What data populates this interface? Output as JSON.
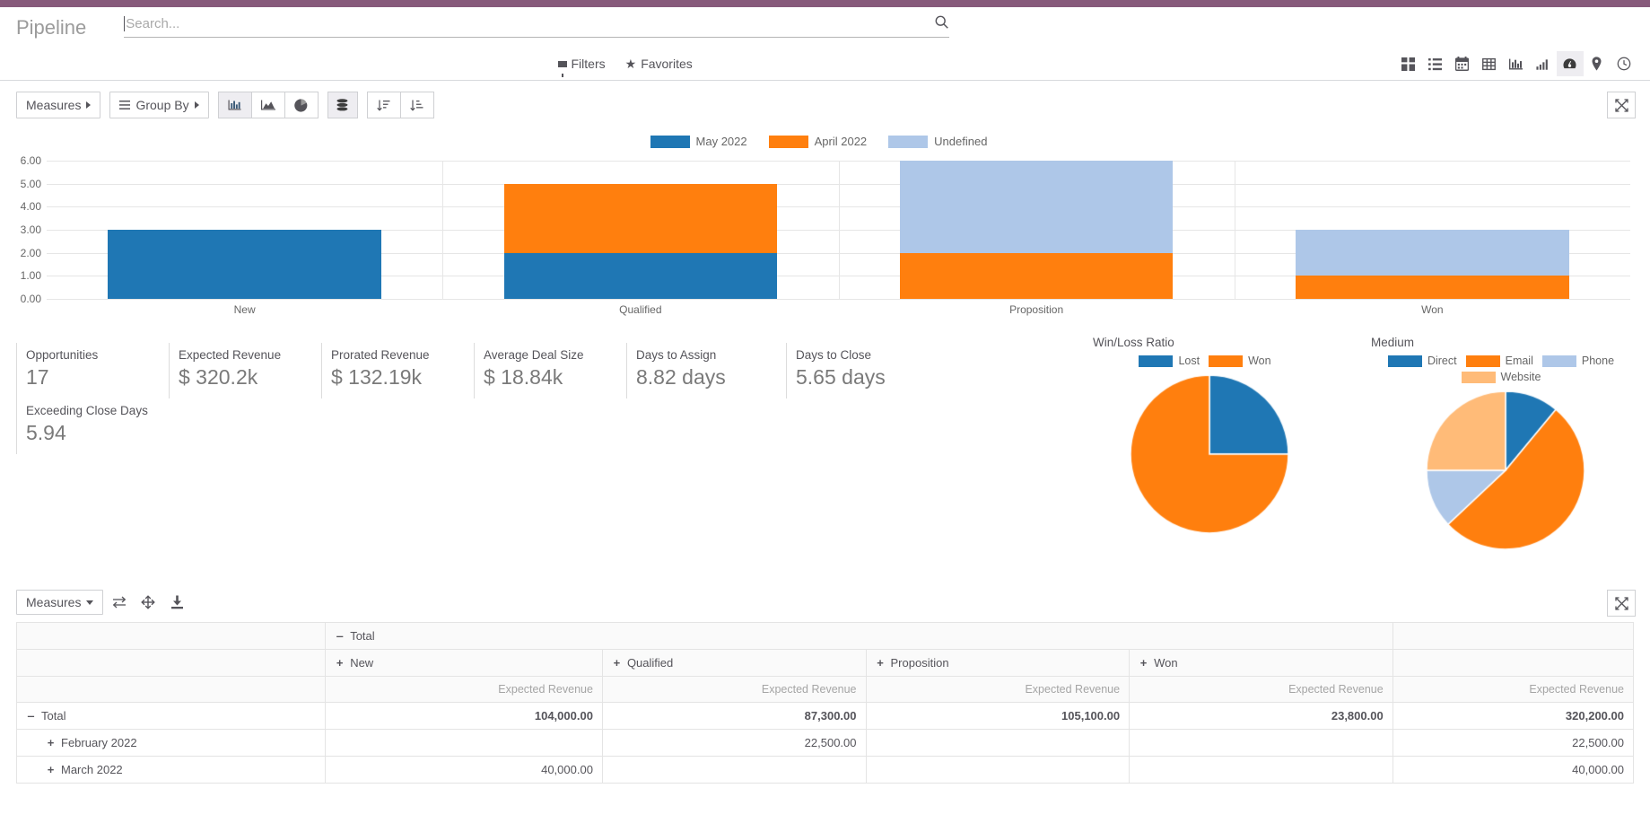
{
  "window": {
    "accent_color": "#875A7B"
  },
  "header": {
    "breadcrumb": "Pipeline",
    "search": {
      "placeholder": "Search...",
      "value": ""
    },
    "filters_label": "Filters",
    "favorites_label": "Favorites",
    "views": [
      {
        "name": "kanban",
        "label": "Kanban",
        "active": false
      },
      {
        "name": "list",
        "label": "List",
        "active": false
      },
      {
        "name": "calendar",
        "label": "Calendar",
        "active": false
      },
      {
        "name": "pivot",
        "label": "Pivot",
        "active": false
      },
      {
        "name": "graph",
        "label": "Graph",
        "active": false
      },
      {
        "name": "cohort",
        "label": "Cohort",
        "active": false
      },
      {
        "name": "dashboard",
        "label": "Dashboard",
        "active": true
      },
      {
        "name": "map",
        "label": "Map",
        "active": false
      },
      {
        "name": "activity",
        "label": "Activity",
        "active": false
      }
    ]
  },
  "graph_toolbar": {
    "measures_label": "Measures",
    "group_by_label": "Group By",
    "chart_types": [
      {
        "name": "bar",
        "active": true
      },
      {
        "name": "line",
        "active": false
      },
      {
        "name": "pie",
        "active": false
      }
    ],
    "stacked_label": "Stacked",
    "sort_asc_label": "Ascending",
    "sort_desc_label": "Descending",
    "expand_label": "Expand"
  },
  "chart_data": [
    {
      "id": "pipeline-bar",
      "type": "bar",
      "stacked": true,
      "title": "",
      "xlabel": "",
      "ylabel": "",
      "categories": [
        "New",
        "Qualified",
        "Proposition",
        "Won"
      ],
      "ylim": [
        0,
        6
      ],
      "yticks": [
        "0.00",
        "1.00",
        "2.00",
        "3.00",
        "4.00",
        "5.00",
        "6.00"
      ],
      "grid": true,
      "legend_position": "top",
      "series": [
        {
          "name": "May 2022",
          "color": "#1f77b4",
          "values": [
            3,
            2,
            0,
            0
          ]
        },
        {
          "name": "April 2022",
          "color": "#ff7f0e",
          "values": [
            0,
            3,
            2,
            1
          ]
        },
        {
          "name": "Undefined",
          "color": "#aec7e8",
          "values": [
            0,
            0,
            4,
            2
          ]
        }
      ]
    },
    {
      "id": "win-loss-pie",
      "type": "pie",
      "title": "Win/Loss Ratio",
      "labels": [
        "Lost",
        "Won"
      ],
      "values": [
        25,
        75
      ],
      "colors": [
        "#1f77b4",
        "#ff7f0e"
      ],
      "legend_position": "top"
    },
    {
      "id": "medium-pie",
      "type": "pie",
      "title": "Medium",
      "labels": [
        "Direct",
        "Email",
        "Phone",
        "Website"
      ],
      "values": [
        11,
        52,
        12,
        25
      ],
      "colors": [
        "#1f77b4",
        "#ff7f0e",
        "#aec7e8",
        "#ffbb78"
      ],
      "legend_position": "top"
    }
  ],
  "kpis": [
    {
      "label": "Opportunities",
      "value": "17"
    },
    {
      "label": "Expected Revenue",
      "value": "$ 320.2k"
    },
    {
      "label": "Prorated Revenue",
      "value": "$ 132.19k"
    },
    {
      "label": "Average Deal Size",
      "value": "$ 18.84k"
    },
    {
      "label": "Days to Assign",
      "value": "8.82 days"
    },
    {
      "label": "Days to Close",
      "value": "5.65 days"
    },
    {
      "label": "Exceeding Close Days",
      "value": "5.94"
    }
  ],
  "pivot": {
    "toolbar": {
      "measures_label": "Measures",
      "flip_axis_label": "Flip axis",
      "expand_all_label": "Expand all",
      "download_label": "Download xlsx",
      "expand_label": "Expand"
    },
    "col_group_total": "Total",
    "col_headers": [
      "New",
      "Qualified",
      "Proposition",
      "Won"
    ],
    "measure_header": "Expected Revenue",
    "total_measure_header": "Expected Revenue",
    "rows": [
      {
        "label": "Total",
        "toggle": "minus",
        "indent": 0,
        "values": [
          "104,000.00",
          "87,300.00",
          "105,100.00",
          "23,800.00"
        ],
        "total": "320,200.00",
        "bold": true
      },
      {
        "label": "February 2022",
        "toggle": "plus",
        "indent": 1,
        "values": [
          "",
          "22,500.00",
          "",
          ""
        ],
        "total": "22,500.00",
        "bold": false
      },
      {
        "label": "March 2022",
        "toggle": "plus",
        "indent": 1,
        "values": [
          "40,000.00",
          "",
          "",
          ""
        ],
        "total": "40,000.00",
        "bold": false
      }
    ]
  }
}
